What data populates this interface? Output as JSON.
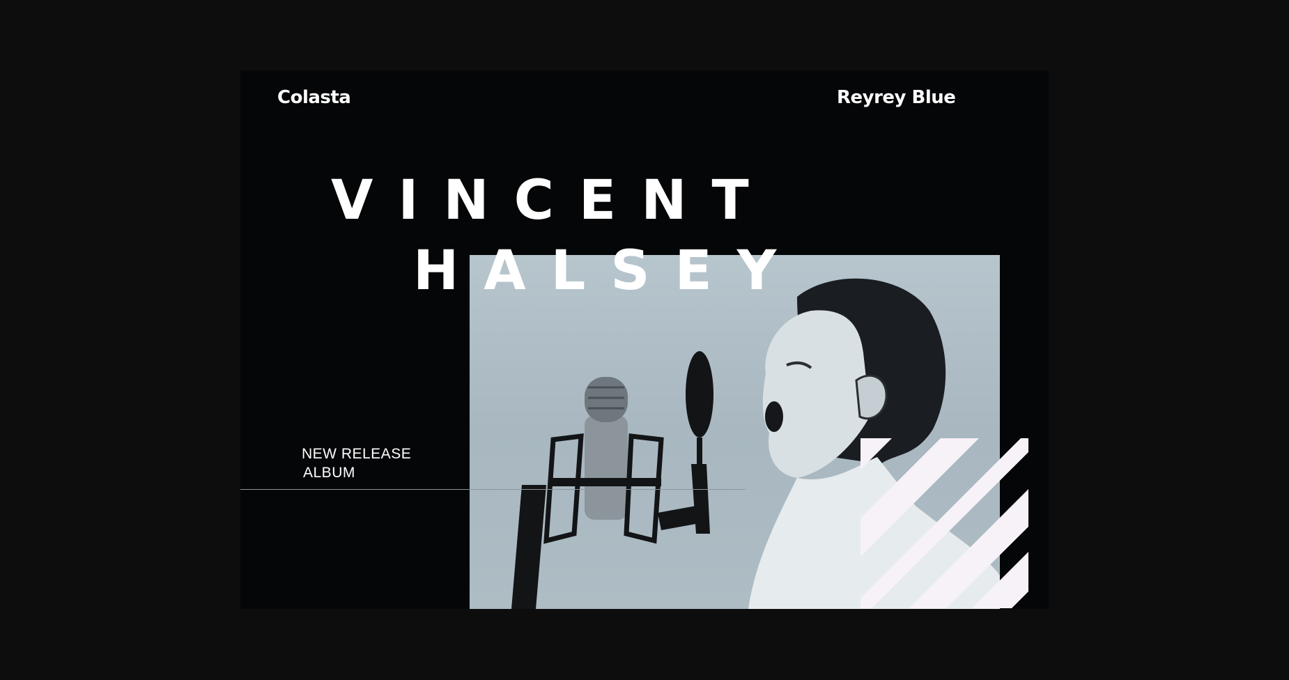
{
  "header": {
    "brand_left": "Colasta",
    "brand_right": "Reyrey Blue"
  },
  "title": {
    "line1": "VINCENT",
    "line2": "HALSEY"
  },
  "release": {
    "line1": "NEW RELEASE",
    "line2": "ALBUM"
  },
  "photo": {
    "subject": "boy-singing-into-microphone-image"
  },
  "colors": {
    "page_bg": "#0d0d0d",
    "card_bg": "#050608",
    "photo_bg": "#b0bec6",
    "text": "#ffffff",
    "stripes": "#f7f2f8"
  }
}
